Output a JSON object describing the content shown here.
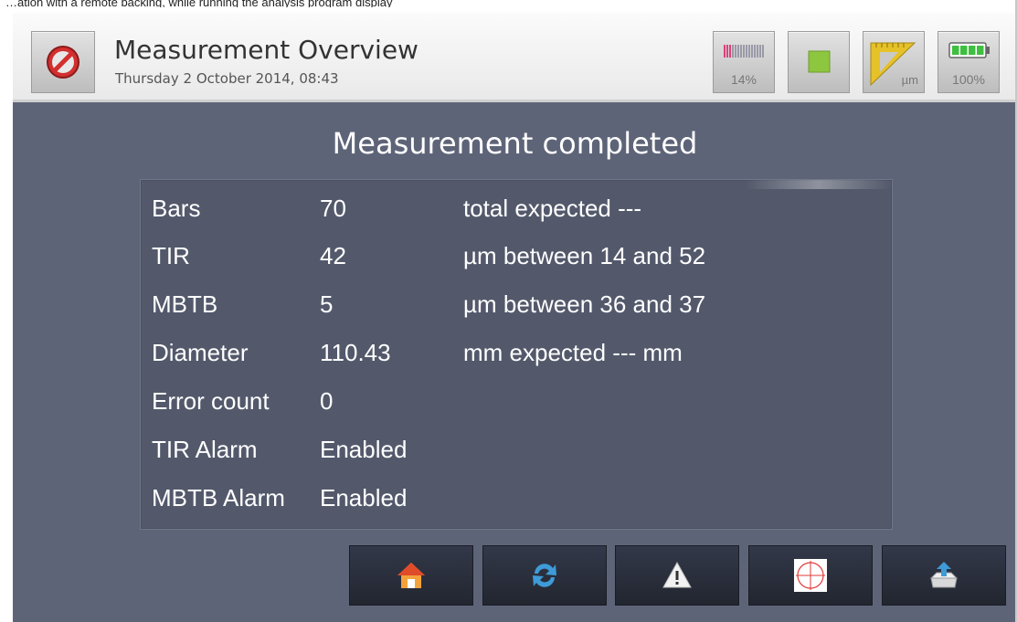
{
  "caption_fragment": "…ation with a remote backing, while running the analysis program display",
  "header": {
    "title": "Measurement Overview",
    "datetime": "Thursday 2 October 2014, 08:43",
    "cancel_icon": "cancel-icon",
    "status_tiles": [
      {
        "icon": "signal-bars-icon",
        "label": "14%"
      },
      {
        "icon": "stop-icon",
        "label": ""
      },
      {
        "icon": "ruler-micrometer-icon",
        "label": "µm"
      },
      {
        "icon": "battery-icon",
        "label": "100%"
      }
    ]
  },
  "main": {
    "title": "Measurement completed",
    "rows": [
      {
        "label": "Bars",
        "value": "70",
        "extra": "total expected ---"
      },
      {
        "label": "TIR",
        "value": "42",
        "extra": "µm between 14 and 52"
      },
      {
        "label": "MBTB",
        "value": "5",
        "extra": "µm between 36 and 37"
      },
      {
        "label": "Diameter",
        "value": "110.43",
        "extra": "mm expected --- mm"
      },
      {
        "label": "Error count",
        "value": "0",
        "extra": ""
      },
      {
        "label": "TIR Alarm",
        "value": "Enabled",
        "extra": ""
      },
      {
        "label": "MBTB Alarm",
        "value": "Enabled",
        "extra": ""
      }
    ]
  },
  "nav": {
    "buttons": [
      {
        "icon": "home-icon"
      },
      {
        "icon": "refresh-icon"
      },
      {
        "icon": "warning-icon"
      },
      {
        "icon": "target-icon"
      },
      {
        "icon": "save-icon"
      }
    ]
  },
  "colors": {
    "background": "#5e6478",
    "panel": "#53596b",
    "nav_button": "#2a2e3a",
    "stop_green": "#8dc63f",
    "battery_green": "#3fbf3f"
  }
}
